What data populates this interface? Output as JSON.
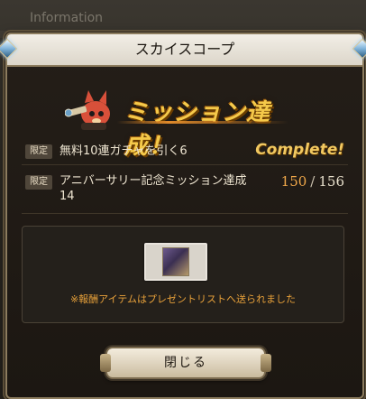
{
  "background": {
    "section_title": "Information"
  },
  "dialog": {
    "title": "スカイスコープ",
    "banner": "ミッション達成！",
    "missions": [
      {
        "tag": "限定",
        "name": "無料10連ガチャを引く6",
        "status": "Complete!"
      },
      {
        "tag": "限定",
        "name": "アニバーサリー記念ミッション達成14",
        "progress_current": "150",
        "progress_separator": "/",
        "progress_total": "156"
      }
    ],
    "reward_note": "※報酬アイテムはプレゼントリストへ送られました",
    "close_label": "閉じる"
  }
}
